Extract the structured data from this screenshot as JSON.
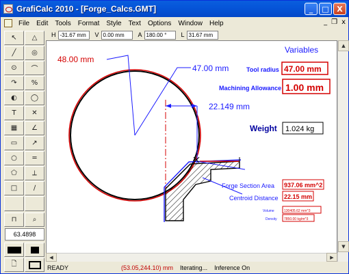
{
  "window": {
    "title": "GrafiCalc 2010 - [Forge_Calcs.GMT]",
    "min_btn": "_",
    "max_btn": "□",
    "close_btn": "X"
  },
  "menu": {
    "items": [
      "File",
      "Edit",
      "Tools",
      "Format",
      "Style",
      "Text",
      "Options",
      "Window",
      "Help"
    ],
    "mdi_controls": [
      "_",
      "❐",
      "x"
    ]
  },
  "coords": {
    "h_label": "H",
    "h_value": "-31.67 mm",
    "v_label": "V",
    "v_value": "0.00 mm",
    "a_label": "A",
    "a_value": "180.00 °",
    "l_label": "L",
    "l_value": "31.67 mm"
  },
  "toolbox": {
    "readout": "63.4898",
    "tools": [
      "select-arrow",
      "triangle",
      "line",
      "circle-point",
      "circle-center",
      "arc",
      "arc-edit",
      "percent-note",
      "circle-tangent",
      "circle-double",
      "text",
      "cross",
      "grid",
      "angle-line",
      "rect-dimension",
      "diagonal-dim",
      "circle-3pt",
      "parallel-lines",
      "polygon",
      "perpendicular",
      "fill-color",
      "slope-line",
      "blank-a",
      "blank-b",
      "offset-tool",
      "zoom-tool"
    ]
  },
  "drawing": {
    "variables_title": "Variables",
    "tool_radius_label": "Tool radius",
    "tool_radius_value": "47.00 mm",
    "machining_allowance_label": "Machining Allowance",
    "machining_allowance_value": "1.00 mm",
    "weight_label": "Weight",
    "weight_value": "1.024 kg",
    "dim_48": "48.00 mm",
    "dim_47": "47.00 mm",
    "dim_22": "22.149 mm",
    "forge_section_area_label": "Forge Section Area",
    "forge_section_area_value": "937.06 mm^2",
    "centroid_distance_label": "Centroid Distance",
    "centroid_distance_value": "22.15 mm",
    "volume_label": "Volume",
    "volume_value": "130405.62 mm^3",
    "density_label": "Density",
    "density_value": "7850.00 kg/m^3",
    "colors": {
      "red": "#d40000",
      "blue": "#1a1aff",
      "navy": "#0000a0"
    }
  },
  "status": {
    "ready": "READY",
    "coordinates": "(53.05,244.10) mm",
    "iterating": "Iterating...",
    "inference": "Inference On"
  }
}
